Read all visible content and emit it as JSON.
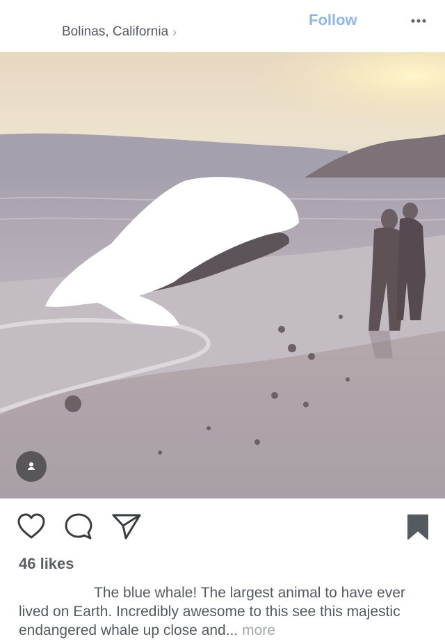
{
  "header": {
    "location": "Bolinas, California",
    "follow_label": "Follow",
    "more_icon": "more-horizontal-icon"
  },
  "post": {
    "photo_description_icon": "user-tag-icon",
    "actions": {
      "like_icon": "heart-icon",
      "comment_icon": "comment-icon",
      "share_icon": "send-icon",
      "save_icon": "bookmark-icon"
    },
    "likes_text": "46 likes",
    "caption": "The blue whale! The largest animal to have ever lived on Earth. Incredibly awesome to this see this majestic endangered whale up close and...",
    "more_label": "more"
  },
  "colors": {
    "accent": "#8eb7e6",
    "text": "#555a60",
    "muted": "#a3a7ad"
  }
}
